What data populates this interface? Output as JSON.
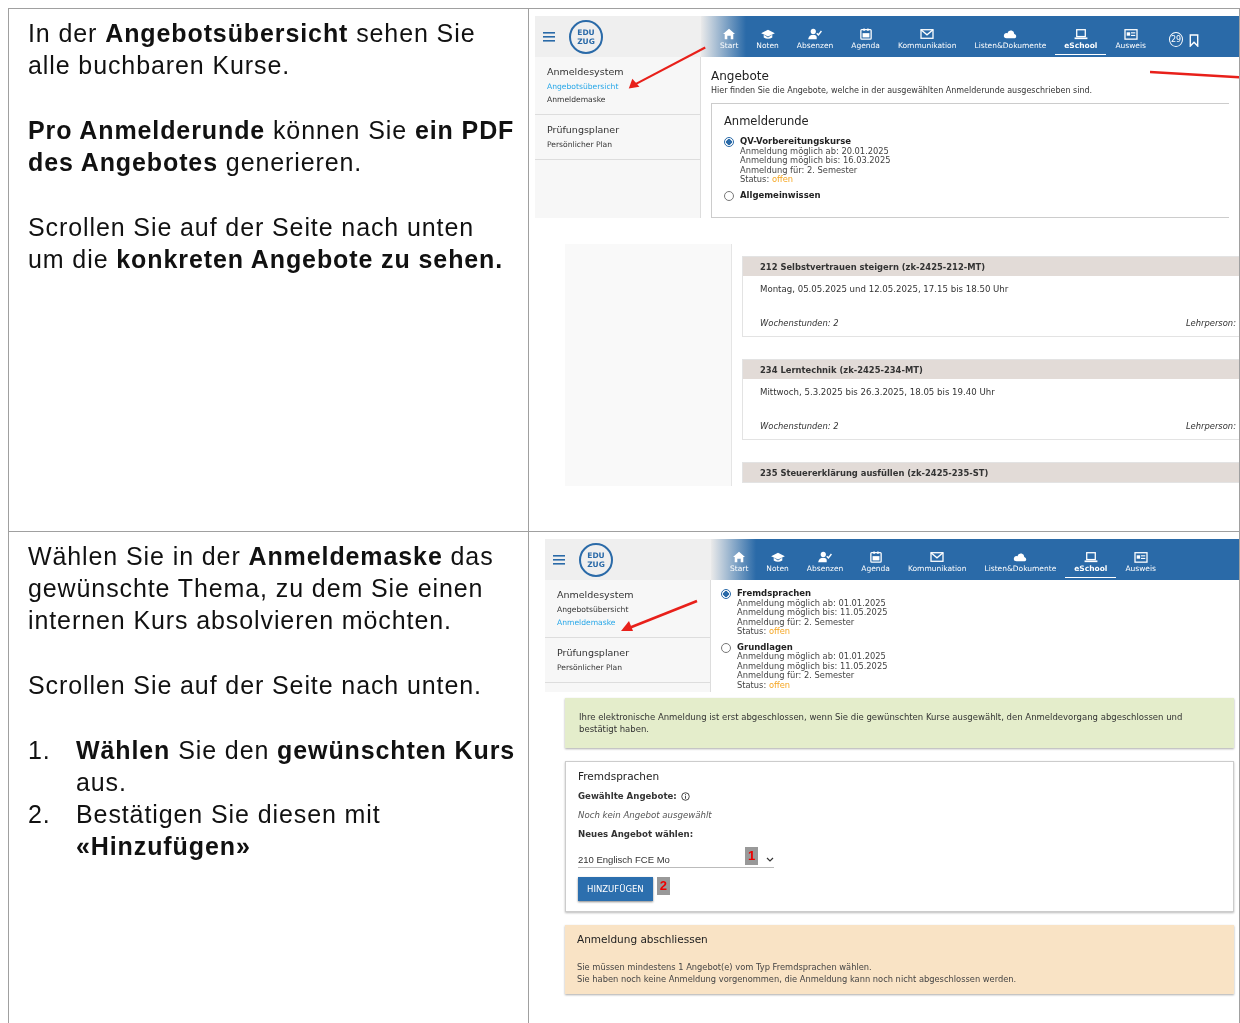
{
  "rows": [
    {
      "instructions": [
        {
          "kind": "paragraph",
          "text": "In der **Angebotsübersicht** sehen Sie alle buchbaren Kurse."
        },
        {
          "kind": "paragraph",
          "text": "**Pro Anmelderunde** können Sie **ein PDF des Angebotes** generieren."
        },
        {
          "kind": "paragraph",
          "text": "Scrollen Sie auf der Seite nach unten um die **konkreten Angebote zu sehen.**"
        }
      ],
      "screenshot": {
        "kind": "overview",
        "app": {
          "logo": [
            "EDU",
            "ZUG"
          ],
          "nav": [
            {
              "label": "Start",
              "selected": false
            },
            {
              "label": "Noten",
              "selected": false
            },
            {
              "label": "Absenzen",
              "selected": false
            },
            {
              "label": "Agenda",
              "selected": false
            },
            {
              "label": "Kommunikation",
              "selected": false
            },
            {
              "label": "Listen&Dokumente",
              "selected": false
            },
            {
              "label": "eSchool",
              "selected": true
            },
            {
              "label": "Ausweis",
              "selected": false
            }
          ],
          "notification_count": "29",
          "sidebar": [
            {
              "title": "Anmeldesystem",
              "items": [
                {
                  "label": "Angebotsübersicht",
                  "selected": true
                },
                {
                  "label": "Anmeldemaske",
                  "selected": false
                }
              ]
            },
            {
              "title": "Prüfungsplaner",
              "items": [
                {
                  "label": "Persönlicher Plan",
                  "selected": false
                }
              ]
            }
          ]
        },
        "title": "Angebote",
        "description": "Hier finden Sie die Angebote, welche in der ausgewählten Anmelderunde ausgeschrieben sind.",
        "rounds_title": "Anmelderunde",
        "rounds": [
          {
            "name": "QV-Vorbereitungskurse",
            "selected": true,
            "lines": [
              "Anmeldung möglich ab: 20.01.2025",
              "Anmeldung möglich bis: 16.03.2025",
              "Anmeldung für: 2. Semester"
            ],
            "status_label": "Status:",
            "status": "offen"
          },
          {
            "name": "Allgemeinwissen",
            "selected": false
          }
        ],
        "courses": [
          {
            "title": "212 Selbstvertrauen steigern (zk-2425-212-MT)",
            "schedule": "Montag, 05.05.2025 und 12.05.2025, 17.15 bis 18.50 Uhr",
            "hours": "Wochenstunden: 2",
            "teacher_label": "Lehrperson:"
          },
          {
            "title": "234 Lerntechnik (zk-2425-234-MT)",
            "schedule": "Mittwoch, 5.3.2025 bis 26.3.2025, 18.05 bis 19.40 Uhr",
            "hours": "Wochenstunden: 2",
            "teacher_label": "Lehrperson:"
          },
          {
            "title": "235 Steuererklärung ausfüllen (zk-2425-235-ST)"
          }
        ]
      }
    },
    {
      "instructions": [
        {
          "kind": "paragraph",
          "text": "Wählen Sie in der **Anmeldemaske** das gewünschte Thema, zu dem Sie einen internen Kurs absolvieren möchten."
        },
        {
          "kind": "paragraph",
          "text": "Scrollen Sie auf der Seite nach unten."
        },
        {
          "kind": "list",
          "items": [
            {
              "number": "1.",
              "text": "**Wählen** Sie den **gewünschten Kurs** aus."
            },
            {
              "number": "2.",
              "text": "Bestätigen Sie diesen mit **«Hinzufügen»**"
            }
          ]
        }
      ],
      "screenshot": {
        "kind": "registration",
        "app": {
          "logo": [
            "EDU",
            "ZUG"
          ],
          "nav": [
            {
              "label": "Start",
              "selected": false
            },
            {
              "label": "Noten",
              "selected": false
            },
            {
              "label": "Absenzen",
              "selected": false
            },
            {
              "label": "Agenda",
              "selected": false
            },
            {
              "label": "Kommunikation",
              "selected": false
            },
            {
              "label": "Listen&Dokumente",
              "selected": false
            },
            {
              "label": "eSchool",
              "selected": true
            },
            {
              "label": "Ausweis",
              "selected": false
            }
          ],
          "sidebar": [
            {
              "title": "Anmeldesystem",
              "items": [
                {
                  "label": "Angebotsübersicht",
                  "selected": false
                },
                {
                  "label": "Anmeldemaske",
                  "selected": true
                }
              ]
            },
            {
              "title": "Prüfungsplaner",
              "items": [
                {
                  "label": "Persönlicher Plan",
                  "selected": false
                }
              ]
            }
          ]
        },
        "rounds": [
          {
            "name": "Fremdsprachen",
            "selected": true,
            "lines": [
              "Anmeldung möglich ab: 01.01.2025",
              "Anmeldung möglich bis: 11.05.2025",
              "Anmeldung für: 2. Semester"
            ],
            "status_label": "Status:",
            "status": "offen"
          },
          {
            "name": "Grundlagen",
            "selected": false,
            "lines": [
              "Anmeldung möglich ab: 01.01.2025",
              "Anmeldung möglich bis: 11.05.2025",
              "Anmeldung für: 2. Semester"
            ],
            "status_label": "Status:",
            "status": "offen"
          }
        ],
        "info": "Ihre elektronische Anmeldung ist erst abgeschlossen, wenn Sie die gewünschten Kurse ausgewählt, den Anmeldevorgang abgeschlossen und bestätigt haben.",
        "card": {
          "title": "Fremdsprachen",
          "chosen_label": "Gewählte Angebote:",
          "chosen_empty": "Noch kein Angebot ausgewählt",
          "new_label": "Neues Angebot wählen:",
          "select_value": "210 Englisch FCE Mo",
          "button": "HINZUFÜGEN",
          "markers": [
            "1",
            "2"
          ]
        },
        "finish": {
          "title": "Anmeldung abschliessen",
          "lines": [
            "Sie müssen mindestens 1 Angebot(e) vom Typ Fremdsprachen wählen.",
            "Sie haben noch keine Anmeldung vorgenommen, die Anmeldung kann noch nicht abgeschlossen werden."
          ]
        }
      }
    }
  ]
}
